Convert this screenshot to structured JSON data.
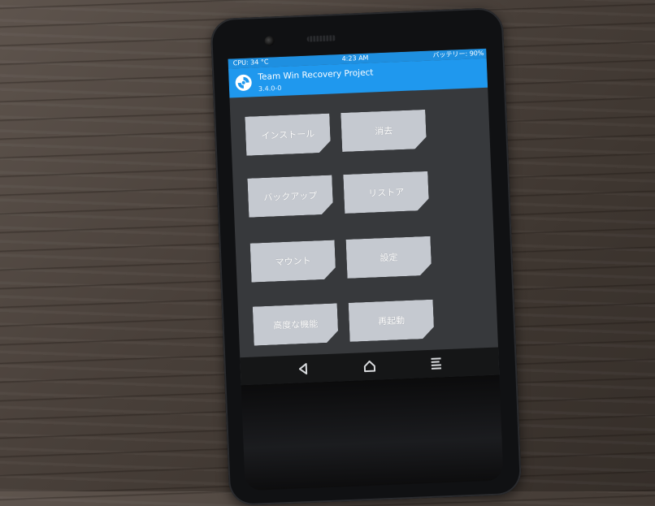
{
  "status_bar": {
    "cpu": "CPU: 34 °C",
    "time": "4:23 AM",
    "battery": "バッテリー: 90%"
  },
  "header": {
    "title": "Team Win Recovery Project",
    "version": "3.4.0-0",
    "logo_icon": "twrp-logo-icon"
  },
  "menu": {
    "install": "インストール",
    "wipe": "消去",
    "backup": "バックアップ",
    "restore": "リストア",
    "mount": "マウント",
    "settings": "設定",
    "advanced": "高度な機能",
    "reboot": "再起動"
  },
  "nav": {
    "back_icon": "back-triangle-icon",
    "home_icon": "home-icon",
    "menu_icon": "menu-lines-icon"
  },
  "colors": {
    "accent": "#1f98ee",
    "button": "#c5c9d0",
    "screen_bg": "#37393c"
  }
}
